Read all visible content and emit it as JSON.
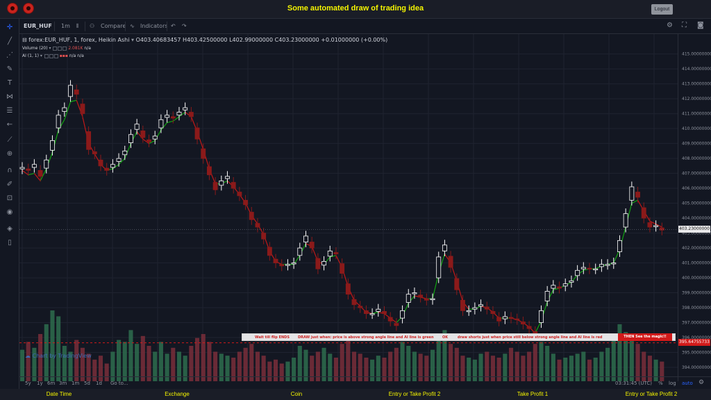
{
  "app": {
    "title": "Some automated draw of trading idea",
    "logout_label": "Logout"
  },
  "toolbar": {
    "symbol": "EUR_HUF",
    "interval": "1m",
    "compare_label": "Compare",
    "indicators_label": "Indicators"
  },
  "legend": {
    "main": "forex:EUR_HUF, 1, forex, Heikin Ashi",
    "open": "O403.40683457",
    "high": "H403.42500000",
    "low": "L402.99000000",
    "close": "C403.23000000",
    "change": "+0.01000000 (+0.00%)",
    "volume_label": "Volume (20)",
    "volume_value": "2.081K",
    "volume_na": "n/a",
    "ai_label": "AI (1, 1)",
    "ai_na1": "n/a",
    "ai_na2": "n/a"
  },
  "price_axis": {
    "labels": [
      "415.00000000",
      "414.00000000",
      "413.00000000",
      "412.00000000",
      "411.00000000",
      "410.00000000",
      "409.00000000",
      "408.00000000",
      "407.00000000",
      "406.00000000",
      "405.00000000",
      "404.00000000",
      "403.00000000",
      "402.00000000",
      "401.00000000",
      "400.00000000",
      "399.00000000",
      "398.00000000",
      "397.00000000",
      "396.00000000",
      "395.00000000",
      "394.00000000"
    ],
    "current_price": "403.23000000",
    "red_price": "395.64755733"
  },
  "time_axis": {
    "labels": [
      "2",
      "13",
      "14",
      "15",
      "17",
      "10:00",
      "19",
      "20",
      "21",
      "22",
      "24",
      "10:00",
      "26",
      "27",
      "28"
    ]
  },
  "bottombar": {
    "ranges": [
      "5y",
      "1y",
      "6m",
      "3m",
      "1m",
      "5d",
      "1d"
    ],
    "goto_label": "Go to...",
    "clock": "03:31:45 (UTC)",
    "percent": "%",
    "log": "log",
    "auto": "auto"
  },
  "watermark": "Chart by TradingView",
  "banner": {
    "msg1": "Wait till flip ENDS",
    "msg2": "DRAW just when: price is above strong angle line and AI line is green",
    "msg3": "OK",
    "msg4": "draw shorts just when price still below strong angle line and AI line is red",
    "magic": "THEN See the magic!!"
  },
  "footer": {
    "cols": [
      "Date Time",
      "Exchange",
      "Coin",
      "Entry or Take Profit 2",
      "Take Profit 1",
      "Entry or Take Profit 2"
    ]
  },
  "colors": {
    "accent_yellow": "#f5f500",
    "up": "#ffffff",
    "down": "#8b1a1a",
    "ai_green": "#11a611",
    "ai_red": "#c01818"
  },
  "chart_data": {
    "type": "line",
    "series": [
      {
        "name": "forex:EUR_HUF, 1, forex, Heikin Ashi",
        "values": [
          407.4,
          407.2,
          407.6,
          406.8,
          407.9,
          409.2,
          410.9,
          411.4,
          412.9,
          412.3,
          411.0,
          408.6,
          408.3,
          407.5,
          407.2,
          407.6,
          408.0,
          408.5,
          409.6,
          410.3,
          409.4,
          409.1,
          409.5,
          410.6,
          410.9,
          410.7,
          411.1,
          411.4,
          410.8,
          409.3,
          408.0,
          406.9,
          405.9,
          406.5,
          406.8,
          406.0,
          405.5,
          404.9,
          403.9,
          403.4,
          402.6,
          401.5,
          401.0,
          400.8,
          400.9,
          401.0,
          402.0,
          402.8,
          402.0,
          400.6,
          401.1,
          401.8,
          401.6,
          400.3,
          398.9,
          398.2,
          398.0,
          397.6,
          397.6,
          397.9,
          397.6,
          397.1,
          396.8,
          397.8,
          398.9,
          399.0,
          398.7,
          398.5,
          398.6,
          401.4,
          402.2,
          400.7,
          399.2,
          397.8,
          397.8,
          398.0,
          398.2,
          397.9,
          397.6,
          397.1,
          397.4,
          397.3,
          397.2,
          396.9,
          396.6,
          396.2,
          397.8,
          399.1,
          399.5,
          399.3,
          399.6,
          399.8,
          400.5,
          400.7,
          400.6,
          400.6,
          400.9,
          400.9,
          401.0,
          402.5,
          404.3,
          406.1,
          405.4,
          404.0,
          403.4,
          403.5,
          403.2
        ]
      }
    ],
    "ylim": [
      394,
      415.5
    ],
    "ai_line_values": [
      407.2,
      406.9,
      407.0,
      406.5,
      407.3,
      408.4,
      409.9,
      410.6,
      411.8,
      411.9,
      410.8,
      409.0,
      408.3,
      407.6,
      407.2,
      407.3,
      407.6,
      408.0,
      409.0,
      409.8,
      409.3,
      409.0,
      409.2,
      409.9,
      410.4,
      410.5,
      410.8,
      411.1,
      410.8,
      409.8,
      408.6,
      407.3,
      406.3,
      406.3,
      406.5,
      406.1,
      405.6,
      405.0,
      404.2,
      403.6,
      402.9,
      401.8,
      401.1,
      400.9,
      400.9,
      400.9,
      401.5,
      402.3,
      402.1,
      401.1,
      400.9,
      401.4,
      401.5,
      400.7,
      399.4,
      398.5,
      398.1,
      397.7,
      397.6,
      397.7,
      397.6,
      397.3,
      397.0,
      397.4,
      398.3,
      398.8,
      398.7,
      398.6,
      398.6,
      400.3,
      401.6,
      401.0,
      399.8,
      398.4,
      397.9,
      397.9,
      398.1,
      398.0,
      397.7,
      397.3,
      397.3,
      397.3,
      397.2,
      397.0,
      396.7,
      396.3,
      397.1,
      398.4,
      399.2,
      399.3,
      399.5,
      399.7,
      400.2,
      400.5,
      400.6,
      400.6,
      400.8,
      400.9,
      401.0,
      401.9,
      403.4,
      405.0,
      405.2,
      404.5,
      403.8,
      403.6,
      403.4
    ],
    "volume": [
      32,
      40,
      34,
      48,
      58,
      72,
      66,
      36,
      30,
      42,
      34,
      28,
      22,
      26,
      18,
      30,
      42,
      40,
      52,
      38,
      46,
      36,
      30,
      40,
      28,
      34,
      30,
      26,
      36,
      44,
      48,
      40,
      30,
      28,
      26,
      24,
      30,
      34,
      38,
      30,
      26,
      20,
      22,
      18,
      20,
      24,
      36,
      32,
      26,
      30,
      34,
      28,
      24,
      38,
      44,
      30,
      28,
      24,
      22,
      26,
      24,
      30,
      34,
      40,
      36,
      30,
      28,
      26,
      32,
      48,
      52,
      38,
      34,
      26,
      24,
      22,
      28,
      30,
      26,
      24,
      28,
      34,
      30,
      26,
      30,
      38,
      40,
      36,
      28,
      22,
      24,
      26,
      28,
      30,
      22,
      24,
      30,
      34,
      42,
      58,
      50,
      44,
      38,
      30,
      26,
      22,
      20
    ]
  }
}
